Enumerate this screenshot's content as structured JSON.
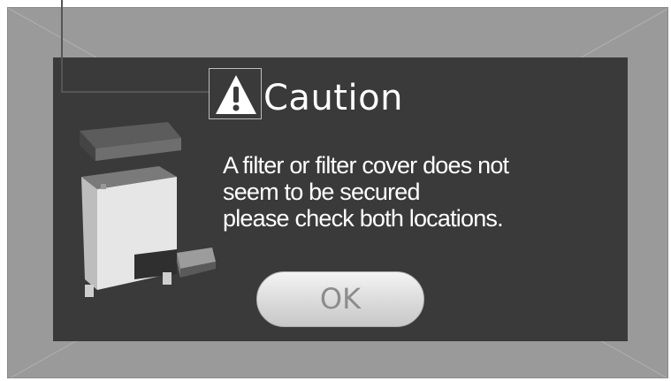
{
  "dialog": {
    "title": "Caution",
    "icon": "warning-icon",
    "message_lines": [
      "A filter or filter cover does not",
      "seem to be secured",
      "please check both locations."
    ],
    "ok_label": "OK",
    "illustration": "air-purifier-device-icon"
  },
  "colors": {
    "frame": "#9a9a9a",
    "dialog_bg": "#3a3a3a",
    "title": "#ffffff",
    "button_text": "#8c8c8c"
  }
}
